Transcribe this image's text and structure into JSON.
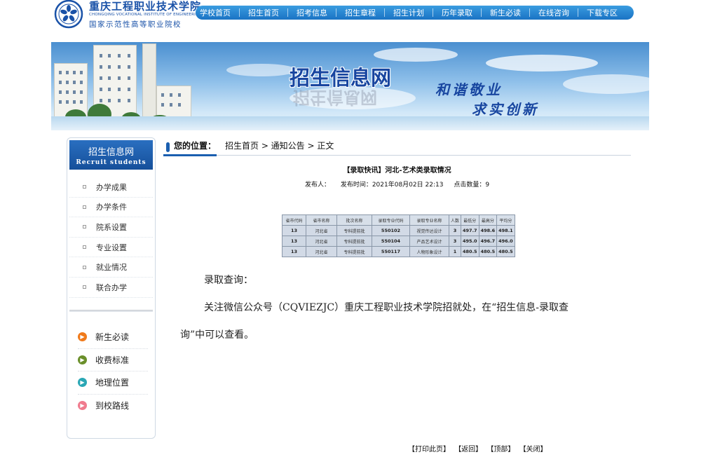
{
  "header": {
    "logo_cn": "重庆工程职业技术学院",
    "logo_en": "CHONGQING VOCATIONAL INSTITUTE OF ENGINEERING",
    "logo_sub": "国家示范性高等职业院校"
  },
  "topnav": [
    {
      "label": "学校首页"
    },
    {
      "label": "招生首页"
    },
    {
      "label": "招考信息"
    },
    {
      "label": "招生章程"
    },
    {
      "label": "招生计划"
    },
    {
      "label": "历年录取"
    },
    {
      "label": "新生必读"
    },
    {
      "label": "在线咨询"
    },
    {
      "label": "下载专区"
    }
  ],
  "banner": {
    "title": "招生信息网",
    "slogan_1": "和谐敬业",
    "slogan_2": "求实创新"
  },
  "sidebar": {
    "title": "招生信息网",
    "subtitle": "Recruit students",
    "items": [
      {
        "label": "办学成果"
      },
      {
        "label": "办学条件"
      },
      {
        "label": "院系设置"
      },
      {
        "label": "专业设置"
      },
      {
        "label": "就业情况"
      },
      {
        "label": "联合办学"
      }
    ],
    "links": [
      {
        "label": "新生必读",
        "color": "#f07a1a"
      },
      {
        "label": "收费标准",
        "color": "#6a8f2a"
      },
      {
        "label": "地理位置",
        "color": "#2aa7b5"
      },
      {
        "label": "到校路线",
        "color": "#f07b8e"
      }
    ]
  },
  "breadcrumb": {
    "label": "您的位置：",
    "path": "招生首页 > 通知公告 > 正文"
  },
  "article": {
    "title": "【录取快讯】河北-艺术类录取情况",
    "publisher": "发布人：",
    "time": "发布时间：2021年08月02日 22:13",
    "views": "点击数量：9",
    "para1": "录取查询：",
    "para2_line1": "关注微信公众号（CQVIEZJC）重庆工程职业技术学院招就处，在“招生信息-录取查",
    "para2_line2": "询”中可以查看。"
  },
  "table": {
    "headers": [
      "省市代码",
      "省市名称",
      "批次名称",
      "录取专业代码",
      "录取专业名称",
      "人数",
      "最低分",
      "最高分",
      "平均分"
    ],
    "rows": [
      [
        "13",
        "河北省",
        "专科提前批",
        "550102",
        "视觉传达设计",
        "3",
        "497.7",
        "498.6",
        "498.1"
      ],
      [
        "13",
        "河北省",
        "专科提前批",
        "550104",
        "产品艺术设计",
        "3",
        "495.0",
        "496.7",
        "496.0"
      ],
      [
        "13",
        "河北省",
        "专科提前批",
        "550117",
        "人物形象设计",
        "1",
        "480.5",
        "480.5",
        "480.5"
      ]
    ]
  },
  "footer": {
    "print": "【打印此页】",
    "back": "【返回】",
    "top": "【顶部】",
    "close": "【关闭】"
  }
}
